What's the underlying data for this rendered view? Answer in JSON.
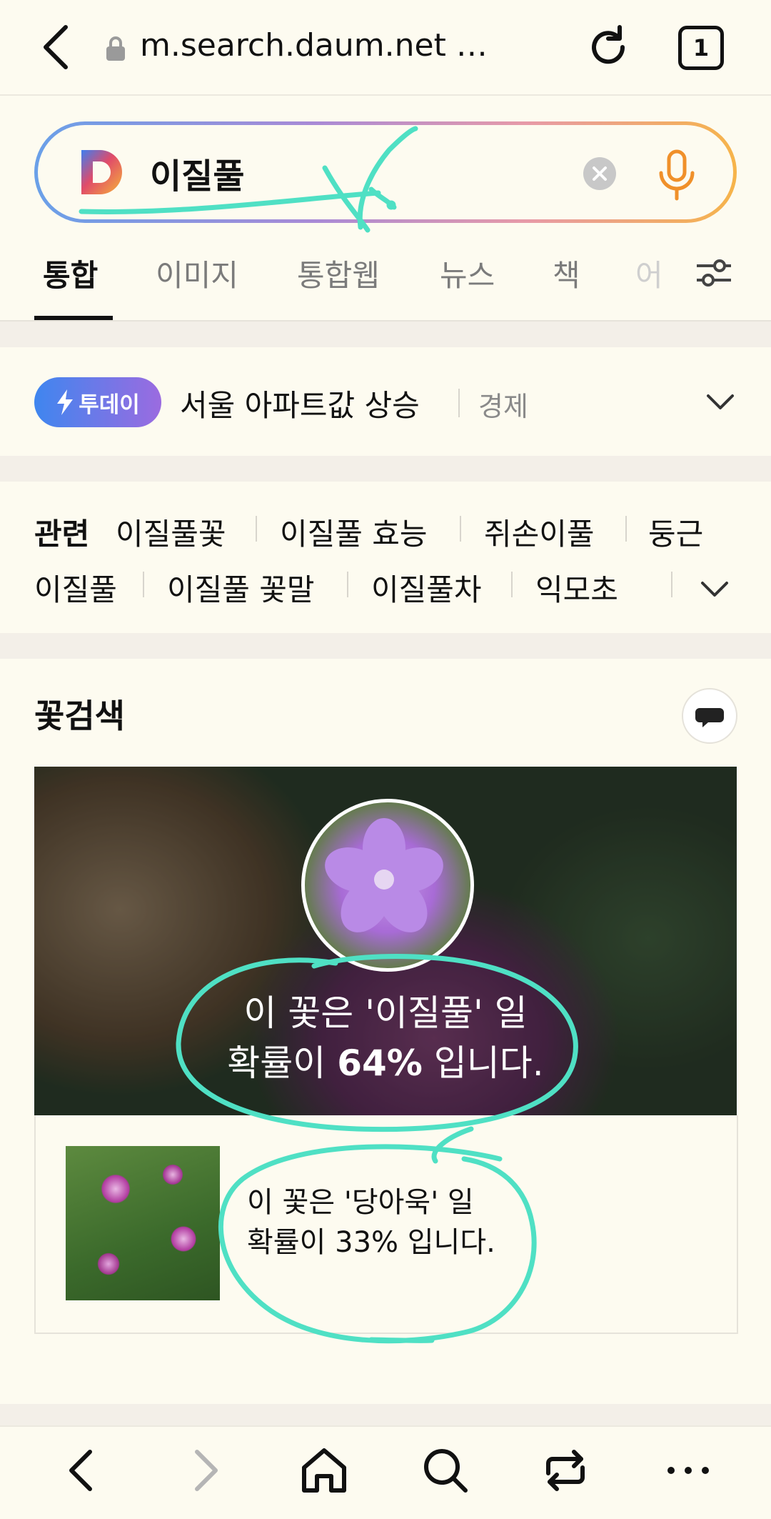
{
  "browser": {
    "url": "m.search.daum.net …",
    "tab_count": "1"
  },
  "search": {
    "query": "이질풀"
  },
  "tabs": [
    {
      "label": "통합",
      "active": true
    },
    {
      "label": "이미지"
    },
    {
      "label": "통합웹"
    },
    {
      "label": "뉴스"
    },
    {
      "label": "책"
    },
    {
      "label": "어"
    }
  ],
  "today": {
    "badge": "투데이",
    "headline": "서울 아파트값 상승",
    "category": "경제"
  },
  "related": {
    "label": "관련",
    "items": [
      "이질풀꽃",
      "이질풀 효능",
      "쥐손이풀",
      "둥근",
      "이질풀",
      "이질풀 꽃말",
      "이질풀차",
      "익모초"
    ]
  },
  "flower_search": {
    "title": "꽃검색",
    "main_result_line1": "이 꽃은 '이질풀' 일",
    "main_result_prefix": "확률이 ",
    "main_result_percent": "64%",
    "main_result_suffix": " 입니다.",
    "alt_result_line1": "이 꽃은 '당아욱' 일",
    "alt_result_line2": "확률이 33% 입니다."
  },
  "colors": {
    "annotation": "#4fe0c4",
    "mic": "#f0902a",
    "badge_start": "#3f86ef",
    "badge_end": "#9b6be0"
  }
}
